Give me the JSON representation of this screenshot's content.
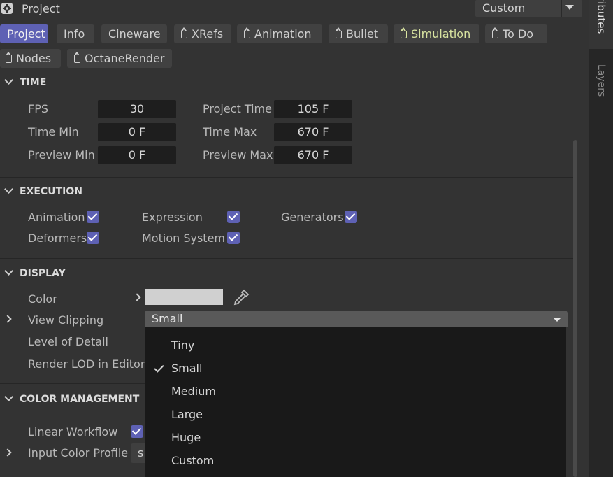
{
  "header": {
    "title": "Project",
    "preset_value": "Custom"
  },
  "right_tabs": {
    "attributes": "ributes",
    "layers": "Layers"
  },
  "tabs": [
    {
      "label": "Project"
    },
    {
      "label": "Info"
    },
    {
      "label": "Cineware"
    },
    {
      "label": "XRefs"
    },
    {
      "label": "Animation"
    },
    {
      "label": "Bullet"
    },
    {
      "label": "Simulation"
    },
    {
      "label": "To Do"
    },
    {
      "label": "Nodes"
    },
    {
      "label": "OctaneRender"
    }
  ],
  "time": {
    "title": "TIME",
    "fps_label": "FPS",
    "fps_value": "30",
    "project_time_label": "Project Time",
    "project_time_value": "105 F",
    "time_min_label": "Time Min",
    "time_min_value": "0 F",
    "time_max_label": "Time Max",
    "time_max_value": "670 F",
    "preview_min_label": "Preview Min",
    "preview_min_value": "0 F",
    "preview_max_label": "Preview Max",
    "preview_max_value": "670 F"
  },
  "execution": {
    "title": "EXECUTION",
    "animation_label": "Animation",
    "expression_label": "Expression",
    "generators_label": "Generators",
    "deformers_label": "Deformers",
    "motion_system_label": "Motion System"
  },
  "display": {
    "title": "DISPLAY",
    "color_label": "Color",
    "color_value": "#d0d0d0",
    "view_clipping_label": "View Clipping",
    "view_clipping_value": "Small",
    "level_of_detail_label": "Level of Detail",
    "render_lod_label": "Render LOD in Editor",
    "clipping_options": [
      "Tiny",
      "Small",
      "Medium",
      "Large",
      "Huge",
      "Custom"
    ]
  },
  "color_management": {
    "title": "COLOR MANAGEMENT",
    "linear_workflow_label": "Linear Workflow",
    "input_color_profile_label": "Input Color Profile",
    "input_color_profile_value": "s"
  },
  "colors": {
    "accent": "#5e61b4",
    "panel": "#333333",
    "field": "#1e1e1e",
    "simulation_tab_text": "#d8e3a0"
  }
}
